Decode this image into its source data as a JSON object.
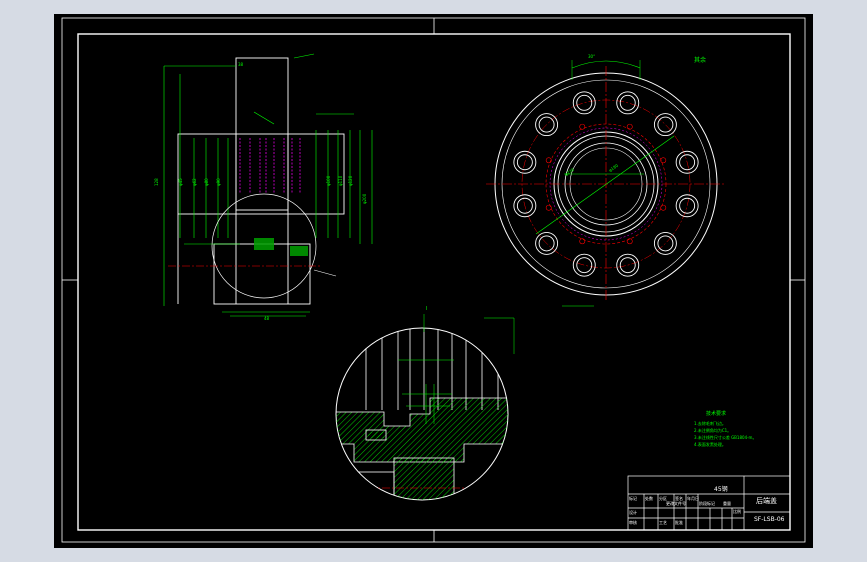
{
  "title_block": {
    "part_name": "后端盖",
    "drawing_no": "SF-LSB-06",
    "material_cell": "45钢",
    "sign_cells": [
      "标记",
      "处数",
      "分区",
      "更改文件号",
      "签名",
      "年月日"
    ],
    "row_labels": [
      "设计",
      "审核",
      "工艺",
      "批准"
    ],
    "stage_labels": [
      "阶段标记",
      "重量",
      "比例"
    ]
  },
  "tech_notes": {
    "heading": "技术要求",
    "lines": [
      "1.去除毛刺飞边。",
      "2.未注倒角均为C1。",
      "3.未注线性尺寸公差 GB1804-m。",
      "4.表面发黑处理。"
    ]
  },
  "views": {
    "top_view_label": "其余",
    "detail_label": "I",
    "section_label": "A-A"
  },
  "colors": {
    "background": "#000000",
    "frame": "#ffffff",
    "dimension": "#00ff00",
    "centerline": "#ff0000",
    "hidden": "#ff00ff",
    "hatch": "#00ff00",
    "workspace": "#d6dbe4"
  }
}
